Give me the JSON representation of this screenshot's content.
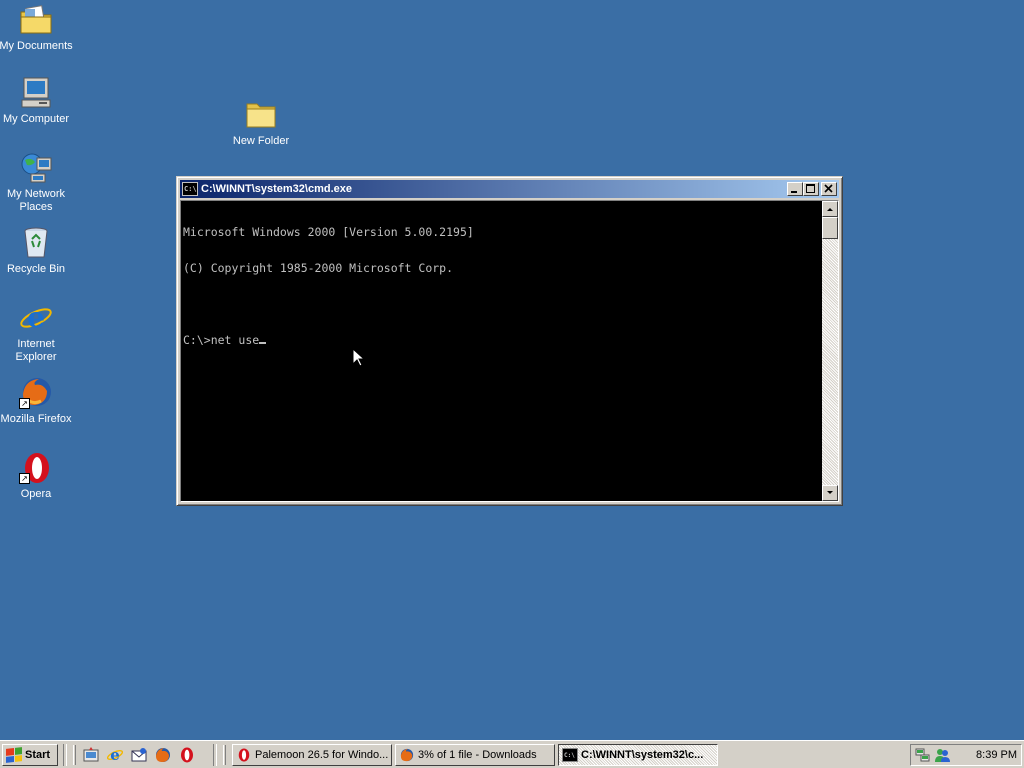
{
  "desktop": {
    "icons": [
      {
        "label": "My Documents",
        "icon": "my-documents-icon"
      },
      {
        "label": "My Computer",
        "icon": "my-computer-icon"
      },
      {
        "label": "My Network Places",
        "icon": "my-network-places-icon"
      },
      {
        "label": "Recycle Bin",
        "icon": "recycle-bin-icon"
      },
      {
        "label": "Internet Explorer",
        "icon": "internet-explorer-icon"
      },
      {
        "label": "Mozilla Firefox",
        "icon": "firefox-icon"
      },
      {
        "label": "Opera",
        "icon": "opera-icon"
      },
      {
        "label": "New Folder",
        "icon": "folder-icon"
      }
    ]
  },
  "window": {
    "title": "C:\\WINNT\\system32\\cmd.exe",
    "buttons": {
      "minimize": "minimize-icon",
      "maximize": "maximize-icon",
      "close": "close-icon"
    },
    "console": {
      "line1": "Microsoft Windows 2000 [Version 5.00.2195]",
      "line2": "(C) Copyright 1985-2000 Microsoft Corp.",
      "prompt": "C:\\>",
      "command": "net use"
    }
  },
  "taskbar": {
    "start_label": "Start",
    "quick_launch": [
      "show-desktop-icon",
      "internet-explorer-icon",
      "outlook-express-icon",
      "firefox-icon",
      "opera-icon"
    ],
    "tasks": [
      {
        "label": "Palemoon 26.5 for Windo...",
        "icon": "opera-icon",
        "active": false
      },
      {
        "label": "3% of 1 file - Downloads",
        "icon": "firefox-icon",
        "active": false
      },
      {
        "label": "C:\\WINNT\\system32\\c...",
        "icon": "cmd-icon",
        "active": true
      }
    ],
    "tray": {
      "icons": [
        "network-icon",
        "msn-messenger-icon"
      ],
      "clock": "8:39 PM"
    }
  },
  "colors": {
    "desktop": "#3a6ea5",
    "titlebar_start": "#0a246a",
    "titlebar_end": "#a6caf0",
    "console_bg": "#000000",
    "console_fg": "#c0c0c0",
    "face": "#d4d0c8"
  }
}
